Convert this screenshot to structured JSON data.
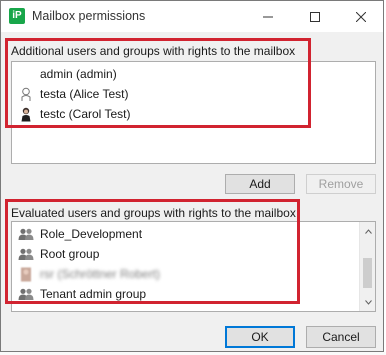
{
  "window": {
    "app_icon_text": "iP",
    "title": "Mailbox permissions"
  },
  "additional": {
    "label": "Additional users and groups with rights to the mailbox",
    "items": [
      {
        "label": "admin (admin)",
        "icon": "none"
      },
      {
        "label": "testa (Alice Test)",
        "icon": "user-outline-icon"
      },
      {
        "label": "testc (Carol Test)",
        "icon": "user-photo-icon"
      }
    ],
    "add_label": "Add",
    "remove_label": "Remove"
  },
  "evaluated": {
    "label": "Evaluated users and groups with rights to the mailbox",
    "items": [
      {
        "label": "Role_Development",
        "icon": "group-icon"
      },
      {
        "label": "Root group",
        "icon": "group-icon"
      },
      {
        "label": "rsr (Schröttner Robert)",
        "icon": "user-photo-icon"
      },
      {
        "label": "Tenant admin group",
        "icon": "group-icon"
      }
    ]
  },
  "footer": {
    "ok_label": "OK",
    "cancel_label": "Cancel"
  },
  "colors": {
    "highlight": "#d12330",
    "app_icon": "#18a64a",
    "default_button_border": "#0078d7"
  }
}
